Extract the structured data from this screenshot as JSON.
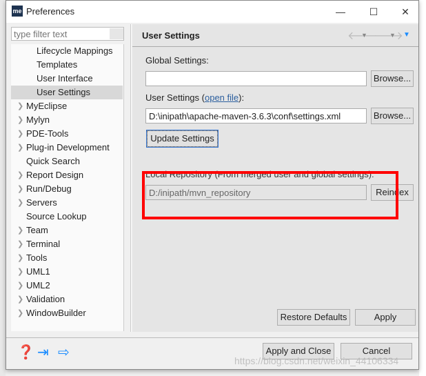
{
  "window": {
    "title": "Preferences",
    "logo": "me",
    "minimize": "—",
    "maximize": "☐",
    "close": "✕"
  },
  "left": {
    "filter_placeholder": "type filter text",
    "sub_items": [
      "Lifecycle Mappings",
      "Templates",
      "User Interface",
      "User Settings"
    ],
    "selected": "User Settings",
    "items": [
      "MyEclipse",
      "Mylyn",
      "PDE-Tools",
      "Plug-in Development",
      "Quick Search",
      "Report Design",
      "Run/Debug",
      "Servers",
      "Source Lookup",
      "Team",
      "Terminal",
      "Tools",
      "UML1",
      "UML2",
      "Validation",
      "WindowBuilder"
    ],
    "expandable": [
      true,
      true,
      true,
      true,
      false,
      true,
      true,
      true,
      false,
      true,
      true,
      true,
      true,
      true,
      true,
      true
    ]
  },
  "page": {
    "title": "User Settings",
    "global_label": "Global Settings:",
    "global_value": "",
    "browse": "Browse...",
    "user_label_pre": "User Settings (",
    "user_link": "open file",
    "user_label_post": "):",
    "user_value": "D:\\inipath\\apache-maven-3.6.3\\conf\\settings.xml",
    "update": "Update Settings",
    "local_label": "Local Repository (From merged user and global settings):",
    "local_value": "D:/inipath/mvn_repository",
    "reindex": "Reindex",
    "restore": "Restore Defaults",
    "apply": "Apply"
  },
  "footer": {
    "apply_close": "Apply and Close",
    "cancel": "Cancel"
  },
  "watermark": "https://blog.csdn.net/weixin_44106334",
  "colors": {
    "highlight": "#ff0000",
    "accent": "#1a8cff"
  }
}
